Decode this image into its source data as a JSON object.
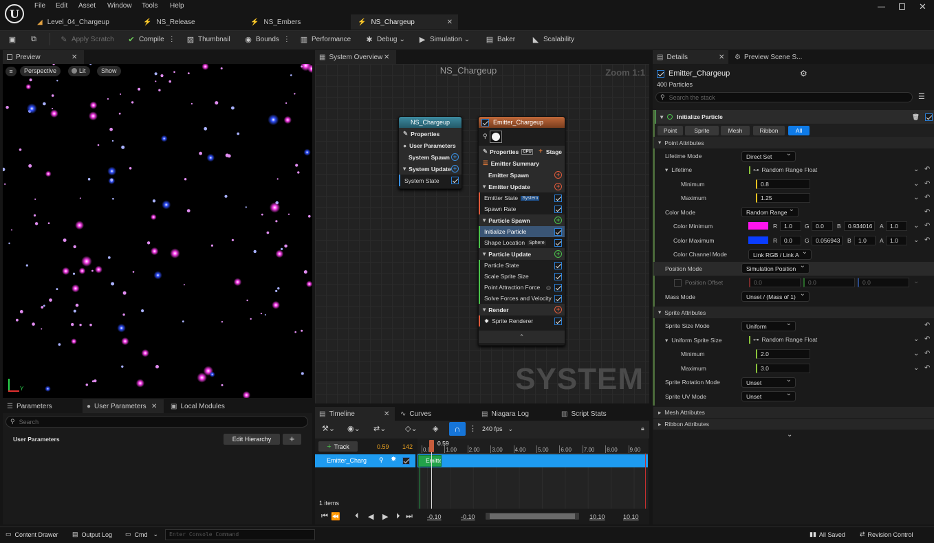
{
  "menu": [
    "File",
    "Edit",
    "Asset",
    "Window",
    "Tools",
    "Help"
  ],
  "doc_tabs": [
    {
      "label": "Level_04_Chargeup"
    },
    {
      "label": "NS_Release"
    },
    {
      "label": "NS_Embers"
    },
    {
      "label": "NS_Chargeup"
    }
  ],
  "toolbar": {
    "apply_scratch": "Apply Scratch",
    "compile": "Compile",
    "thumbnail": "Thumbnail",
    "bounds": "Bounds",
    "performance": "Performance",
    "debug": "Debug",
    "simulation": "Simulation",
    "baker": "Baker",
    "scalability": "Scalability"
  },
  "preview": {
    "tab": "Preview",
    "perspective": "Perspective",
    "lit": "Lit",
    "show": "Show"
  },
  "system_overview": {
    "tab": "System Overview",
    "title": "NS_Chargeup",
    "zoom": "Zoom 1:1",
    "watermark": "SYSTEM",
    "system_node": {
      "title": "NS_Chargeup",
      "rows": [
        "Properties",
        "User Parameters",
        "System Spawn",
        "System Update",
        "System State"
      ]
    },
    "emitter_node": {
      "title": "Emitter_Chargeup",
      "properties": "Properties",
      "cpu": "CPU",
      "stage": "Stage",
      "emitter_summary": "Emitter Summary",
      "emitter_spawn": "Emitter Spawn",
      "emitter_update": "Emitter Update",
      "emitter_state": "Emitter State",
      "emitter_state_badge": "System",
      "spawn_rate": "Spawn Rate",
      "particle_spawn": "Particle Spawn",
      "initialize_particle": "Initialize Particle",
      "shape_location": "Shape Location",
      "shape_badge": "Sphere",
      "particle_update": "Particle Update",
      "particle_state": "Particle State",
      "scale_sprite_size": "Scale Sprite Size",
      "point_attraction": "Point Attraction Force",
      "solve_forces": "Solve Forces and Velocity",
      "render": "Render",
      "sprite_renderer": "Sprite Renderer"
    }
  },
  "params": {
    "tabs": [
      "Parameters",
      "User Parameters",
      "Local Modules"
    ],
    "search_placeholder": "Search",
    "header": "User Parameters",
    "edit_hierarchy": "Edit Hierarchy"
  },
  "timeline": {
    "tabs": [
      "Timeline",
      "Curves",
      "Niagara Log",
      "Script Stats"
    ],
    "fps": "240 fps",
    "track_button": "Track",
    "time_current": "0.59",
    "frame": "142",
    "playhead_label": "0.59",
    "ticks": [
      "0.00",
      "1.00",
      "2.00",
      "3.00",
      "4.00",
      "5.00",
      "6.00",
      "7.00",
      "8.00",
      "9.00"
    ],
    "track_name": "Emitter_Charg",
    "clip_label": "Emitte",
    "items": "1 items",
    "range_start": "-0.10",
    "range_start2": "-0.10",
    "range_end": "10.10",
    "range_end2": "10.10"
  },
  "details": {
    "tab": "Details",
    "tab2": "Preview Scene S...",
    "emitter": "Emitter_Chargeup",
    "particles": "400 Particles",
    "search_placeholder": "Search the stack",
    "module": "Initialize Particle",
    "filters": [
      "Point",
      "Sprite",
      "Mesh",
      "Ribbon",
      "All"
    ],
    "point_attributes": "Point Attributes",
    "lifetime_mode_label": "Lifetime Mode",
    "lifetime_mode": "Direct Set",
    "lifetime_label": "Lifetime",
    "lifetime_fn": "Random Range Float",
    "minimum_label": "Minimum",
    "lifetime_min": "0.8",
    "maximum_label": "Maximum",
    "lifetime_max": "1.25",
    "color_mode_label": "Color Mode",
    "color_mode": "Random Range",
    "color_min_label": "Color Minimum",
    "color_min": {
      "r": "1.0",
      "g": "0.0",
      "b": "0.934016",
      "a": "1.0",
      "swatch": "#ff14ee"
    },
    "color_max_label": "Color Maximum",
    "color_max": {
      "r": "0.0",
      "g": "0.056943",
      "b": "1.0",
      "a": "1.0",
      "swatch": "#0a3cff"
    },
    "color_channel_label": "Color Channel Mode",
    "color_channel": "Link RGB / Link A",
    "position_mode_label": "Position Mode",
    "position_mode": "Simulation Position",
    "position_offset_label": "Position Offset",
    "offset": [
      "0.0",
      "0.0",
      "0.0"
    ],
    "mass_mode_label": "Mass Mode",
    "mass_mode": "Unset / (Mass of 1)",
    "sprite_attributes": "Sprite Attributes",
    "sprite_size_mode_label": "Sprite Size Mode",
    "sprite_size_mode": "Uniform",
    "uniform_size_label": "Uniform Sprite Size",
    "uniform_fn": "Random Range Float",
    "size_min": "2.0",
    "size_max": "3.0",
    "rotation_mode_label": "Sprite Rotation Mode",
    "rotation_mode": "Unset",
    "uv_mode_label": "Sprite UV Mode",
    "uv_mode": "Unset",
    "mesh_attributes": "Mesh Attributes",
    "ribbon_attributes": "Ribbon Attributes",
    "channel_letters": [
      "R",
      "G",
      "B",
      "A"
    ]
  },
  "statusbar": {
    "content_drawer": "Content Drawer",
    "output_log": "Output Log",
    "cmd": "Cmd",
    "console_placeholder": "Enter Console Command",
    "all_saved": "All Saved",
    "revision": "Revision Control"
  },
  "colors": {
    "accent": "#0e7be8",
    "track": "#1e9bf0",
    "clip": "#22a34a",
    "pink": "#ff14ee",
    "blue": "#0a3cff"
  }
}
